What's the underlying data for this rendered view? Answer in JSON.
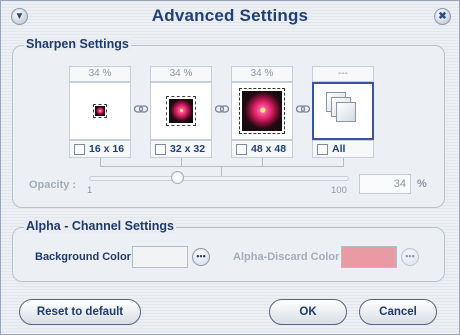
{
  "window": {
    "title": "Advanced Settings"
  },
  "sharpen": {
    "title": "Sharpen Settings",
    "items": [
      {
        "percent": "34 %",
        "size": "16 x 16",
        "checked": false
      },
      {
        "percent": "34 %",
        "size": "32 x 32",
        "checked": false
      },
      {
        "percent": "34 %",
        "size": "48 x 48",
        "checked": false
      },
      {
        "percent": "---",
        "size": "All",
        "checked": false
      }
    ],
    "opacity": {
      "label": "Opacity :",
      "min_label": "1",
      "max_label": "100",
      "value": "34",
      "unit": "%"
    }
  },
  "alpha": {
    "title": "Alpha - Channel Settings",
    "background_label": "Background Color :",
    "background_color": "#f2f3f5",
    "discard_label": "Alpha-Discard Color :",
    "discard_color": "#e99aa3",
    "more_glyph": "•••"
  },
  "buttons": {
    "reset": "Reset to default",
    "ok": "OK",
    "cancel": "Cancel"
  },
  "icons": {
    "collapse": "▼",
    "close": "✖"
  }
}
